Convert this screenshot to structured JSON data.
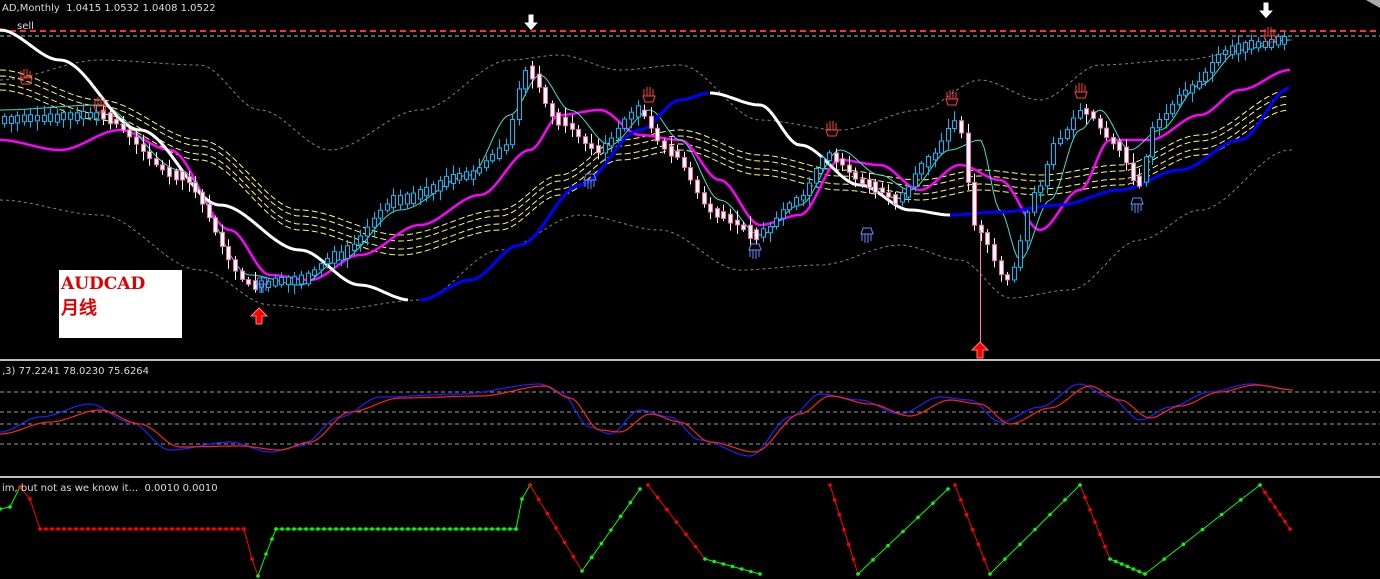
{
  "main": {
    "header": "AD,Monthly  1.0415 1.0532 1.0408 1.0522",
    "level_tag": "sell",
    "label": {
      "symbol": "AUDCAD",
      "period": "月线"
    }
  },
  "stoch": {
    "header": ",3) 77.2241 78.0230 75.6264"
  },
  "osc": {
    "header": "im, but not as we know it...  0.0010 0.0010"
  },
  "colors": {
    "background": "#000000",
    "bull_candle": "#00bfff",
    "bear_candle": "#ffffff",
    "ma_white": "#ffffff",
    "ma_blue": "#0000ff",
    "ma_magenta": "#ff00ff",
    "ma_cyan": "#40e0d0",
    "envelope_yellow": "#ffff66",
    "band_gray": "#808080",
    "level_red": "#ff3030",
    "stoch_blue": "#2020ff",
    "stoch_red": "#ff2020",
    "osc_green": "#00ff00",
    "osc_red": "#ff0000"
  }
}
